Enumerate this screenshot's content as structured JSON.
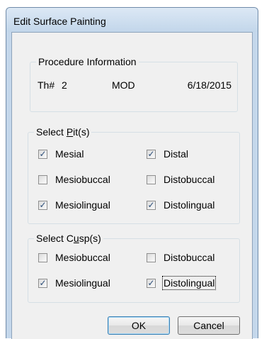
{
  "window": {
    "title": "Edit Surface Painting"
  },
  "procedure": {
    "legend": "Procedure Information",
    "tooth_label": "Th#",
    "tooth_number": "2",
    "surfaces": "MOD",
    "date": "6/18/2015"
  },
  "pits": {
    "legend_before": "Select ",
    "legend_mnemonic": "P",
    "legend_after": "it(s)",
    "items": [
      {
        "label": "Mesial",
        "checked": true
      },
      {
        "label": "Distal",
        "checked": true
      },
      {
        "label": "Mesiobuccal",
        "checked": false
      },
      {
        "label": "Distobuccal",
        "checked": false
      },
      {
        "label": "Mesiolingual",
        "checked": true
      },
      {
        "label": "Distolingual",
        "checked": true
      }
    ]
  },
  "cusps": {
    "legend_before": "Select C",
    "legend_mnemonic": "u",
    "legend_after": "sp(s)",
    "items": [
      {
        "label": "Mesiobuccal",
        "checked": false
      },
      {
        "label": "Distobuccal",
        "checked": false
      },
      {
        "label": "Mesiolingual",
        "checked": true
      },
      {
        "label": "Distolingual",
        "checked": true
      }
    ]
  },
  "buttons": {
    "ok": "OK",
    "cancel": "Cancel"
  }
}
